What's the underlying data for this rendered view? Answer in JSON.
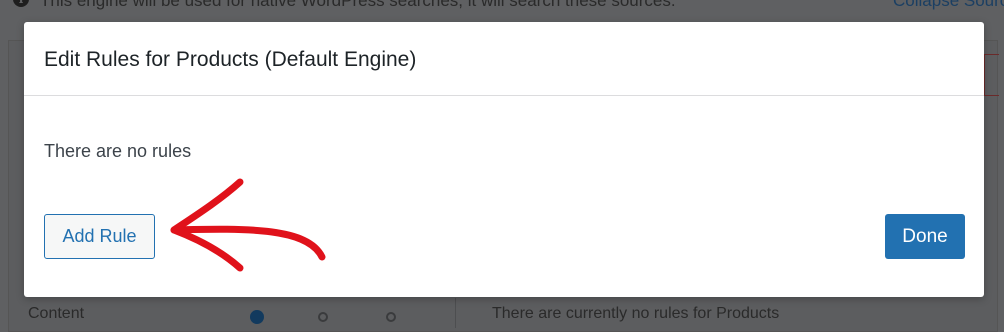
{
  "background": {
    "notice_text": "This engine will be used for native WordPress searches, it will search these sources.",
    "collapse_link": "Collapse Sources",
    "content_label": "Content",
    "no_rules_text": "There are currently no rules for Products"
  },
  "modal": {
    "title": "Edit Rules for Products (Default Engine)",
    "empty_text": "There are no rules",
    "add_rule_label": "Add Rule",
    "done_label": "Done"
  },
  "colors": {
    "accent": "#2271b1",
    "annotation_arrow": "#e0121b",
    "overlay": "#5f6062"
  },
  "icons": {
    "info": "info-icon",
    "annotation": "arrow-annotation-icon"
  }
}
